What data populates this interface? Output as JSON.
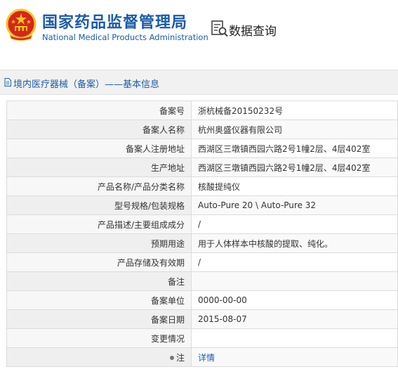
{
  "header": {
    "agency_cn": "国家药品监督管理局",
    "agency_en": "National Medical Products Administration",
    "emblem_icon": "national-emblem-icon",
    "query_icon": "data-search-icon",
    "query_title": "数据查询"
  },
  "breadcrumb": {
    "icon": "document-icon",
    "text": "境内医疗器械（备案）——基本信息"
  },
  "rows": [
    {
      "label": "备案号",
      "value": "浙杭械备20150232号"
    },
    {
      "label": "备案人名称",
      "value": "杭州奥盛仪器有限公司"
    },
    {
      "label": "备案人注册地址",
      "value": "西湖区三墩镇西园六路2号1幢2层、4层402室"
    },
    {
      "label": "生产地址",
      "value": "西湖区三墩镇西园六路2号1幢2层、4层402室"
    },
    {
      "label": "产品名称/产品分类名称",
      "value": "核酸提纯仪"
    },
    {
      "label": "型号规格/包装规格",
      "value": "Auto-Pure 20 \\ Auto-Pure 32"
    },
    {
      "label": "产品描述/主要组成成分",
      "value": "/"
    },
    {
      "label": "预期用途",
      "value": "用于人体样本中核酸的提取、纯化。"
    },
    {
      "label": "产品存储及有效期",
      "value": "/"
    },
    {
      "label": "备注",
      "value": ""
    },
    {
      "label": "备案单位",
      "value": "0000-00-00"
    },
    {
      "label": "备案日期",
      "value": "2015-08-07"
    },
    {
      "label": "变更情况",
      "value": ""
    },
    {
      "label": "注",
      "value": "详情"
    }
  ],
  "colors": {
    "brand_blue": "#1b5bab",
    "emblem_red": "#d8261c",
    "emblem_gold": "#f3c623"
  }
}
